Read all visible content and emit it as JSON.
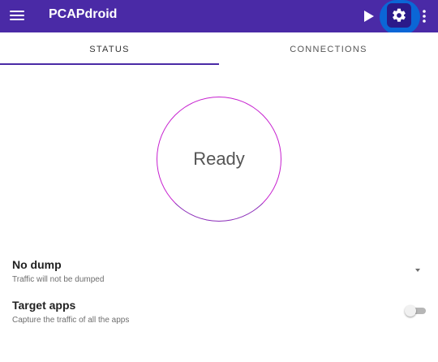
{
  "appbar": {
    "title": "PCAPdroid",
    "icons": [
      "menu-icon",
      "play-icon",
      "gear-icon",
      "more-vert-icon"
    ],
    "color": "#4a2aa6",
    "settings_highlight_color": "#0b66d6"
  },
  "tabs": [
    {
      "label": "STATUS",
      "selected": true
    },
    {
      "label": "CONNECTIONS",
      "selected": false
    }
  ],
  "status": {
    "label": "Ready"
  },
  "settings": {
    "dump": {
      "title": "No dump",
      "subtitle": "Traffic will not be dumped"
    },
    "target": {
      "title": "Target apps",
      "subtitle": "Capture the traffic of all the apps",
      "enabled": false
    }
  }
}
